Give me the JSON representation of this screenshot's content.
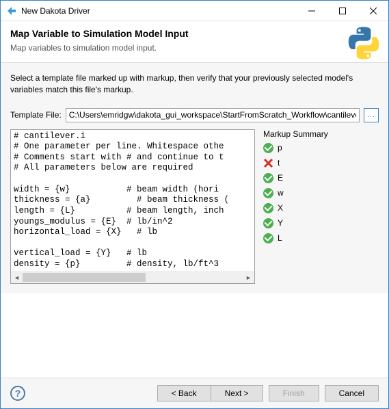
{
  "window": {
    "title": "New Dakota Driver"
  },
  "header": {
    "title": "Map Variable to Simulation Model Input",
    "subtitle": "Map variables to simulation model input."
  },
  "instructions": "Select a template file marked up with markup, then verify that your previously selected model's variables match this file's markup.",
  "templateFile": {
    "label": "Template File:",
    "value": "C:\\Users\\emridgw\\dakota_gui_workspace\\StartFromScratch_Workflow\\cantileve"
  },
  "codeText": "# cantilever.i\n# One parameter per line. Whitespace othe\n# Comments start with # and continue to t\n# All parameters below are required\n\nwidth = {w}           # beam width (hori\nthickness = {a}         # beam thickness (\nlength = {L}          # beam length, inch\nyoungs_modulus = {E}  # lb/in^2\nhorizontal_load = {X}   # lb\n\nvertical_load = {Y}   # lb\ndensity = {p}         # density, lb/ft^3",
  "markup": {
    "title": "Markup Summary",
    "items": [
      {
        "label": "p",
        "status": "ok"
      },
      {
        "label": "t",
        "status": "err"
      },
      {
        "label": "E",
        "status": "ok"
      },
      {
        "label": "w",
        "status": "ok"
      },
      {
        "label": "X",
        "status": "ok"
      },
      {
        "label": "Y",
        "status": "ok"
      },
      {
        "label": "L",
        "status": "ok"
      }
    ]
  },
  "buttons": {
    "back": "< Back",
    "next": "Next >",
    "finish": "Finish",
    "cancel": "Cancel"
  }
}
